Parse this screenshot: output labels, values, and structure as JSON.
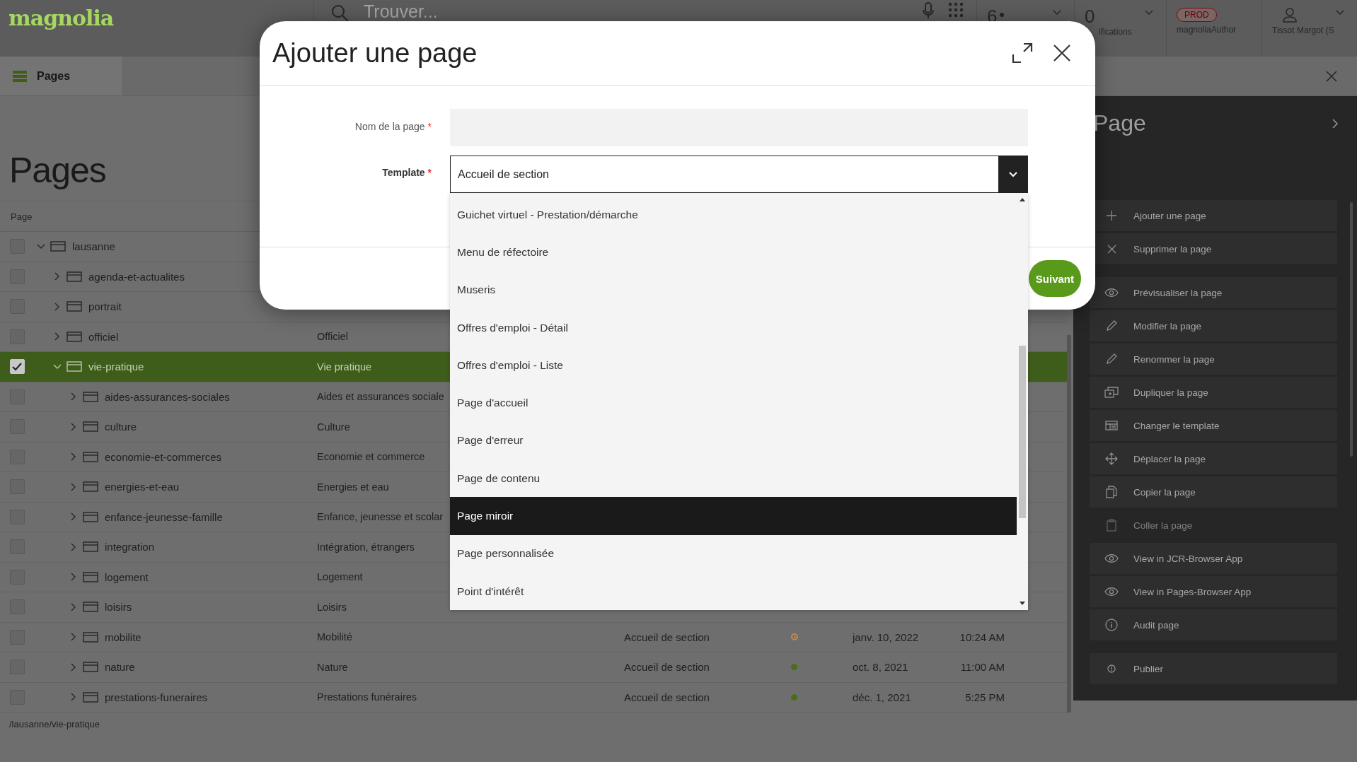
{
  "app": {
    "logo": "magnolia",
    "search": {
      "placeholder": "Trouver..."
    },
    "tasks_count": "6",
    "notifications": {
      "count": "0",
      "label": "ifications"
    },
    "environment": {
      "badge": "PROD",
      "user_role": "magnoliaAuthor"
    },
    "user": {
      "name": "Tissot Margot (S"
    }
  },
  "tab": {
    "label": "Pages"
  },
  "workspace": {
    "title": "Pages",
    "table": {
      "columns": [
        "Page"
      ],
      "rows": [
        {
          "name": "lausanne",
          "selected": false,
          "expanded": true,
          "children": [
            {
              "name": "agenda-et-actualites",
              "selected": false,
              "expanded": false
            },
            {
              "name": "portrait",
              "selected": false,
              "expanded": false
            },
            {
              "name": "officiel",
              "title": "Officiel",
              "selected": false,
              "expanded": false
            },
            {
              "name": "vie-pratique",
              "title": "Vie pratique",
              "selected": true,
              "expanded": true,
              "children": [
                {
                  "name": "aides-assurances-sociales",
                  "title": "Aides et assurances sociale",
                  "selected": false,
                  "expanded": false
                },
                {
                  "name": "culture",
                  "title": "Culture",
                  "selected": false,
                  "expanded": false
                },
                {
                  "name": "economie-et-commerces",
                  "title": "Economie et commerce",
                  "selected": false,
                  "expanded": false
                },
                {
                  "name": "energies-et-eau",
                  "title": "Energies et eau",
                  "selected": false,
                  "expanded": false
                },
                {
                  "name": "enfance-jeunesse-famille",
                  "title": "Enfance, jeunesse et scolar",
                  "selected": false,
                  "expanded": false
                },
                {
                  "name": "integration",
                  "title": "Intégration, étrangers",
                  "selected": false,
                  "expanded": false
                },
                {
                  "name": "logement",
                  "title": "Logement",
                  "selected": false,
                  "expanded": false
                },
                {
                  "name": "loisirs",
                  "title": "Loisirs",
                  "selected": false,
                  "expanded": false
                },
                {
                  "name": "mobilite",
                  "title": "Mobilité",
                  "template": "Accueil de section",
                  "status": {
                    "kind": "modified",
                    "color": "#c08a4a"
                  },
                  "date": "janv. 10, 2022",
                  "time": "10:24 AM",
                  "selected": false,
                  "expanded": false
                },
                {
                  "name": "nature",
                  "title": "Nature",
                  "template": "Accueil de section",
                  "status": {
                    "kind": "published",
                    "color": "#4a6e1c"
                  },
                  "date": "oct. 8, 2021",
                  "time": "11:00 AM",
                  "selected": false,
                  "expanded": false
                },
                {
                  "name": "prestations-funeraires",
                  "title": "Prestations funéraires",
                  "template": "Accueil de section",
                  "status": {
                    "kind": "published",
                    "color": "#4a6e1c"
                  },
                  "date": "déc. 1, 2021",
                  "time": "5:25 PM",
                  "selected": false,
                  "expanded": false
                }
              ]
            }
          ]
        }
      ]
    },
    "path": "/lausanne/vie-pratique"
  },
  "action_panel": {
    "title": "Page",
    "groups": [
      {
        "items": [
          {
            "label": "Ajouter une page",
            "disabled": false
          },
          {
            "label": "Supprimer la page",
            "disabled": false
          }
        ]
      },
      {
        "items": [
          {
            "label": "Prévisualiser la page",
            "disabled": false
          },
          {
            "label": "Modifier la page",
            "disabled": false
          },
          {
            "label": "Renommer la page",
            "disabled": false
          },
          {
            "label": "Dupliquer la page",
            "disabled": false
          },
          {
            "label": "Changer le template",
            "disabled": false
          },
          {
            "label": "Déplacer la page",
            "disabled": false
          },
          {
            "label": "Copier la page",
            "disabled": false
          },
          {
            "label": "Coller la page",
            "disabled": true
          },
          {
            "label": "View in JCR-Browser App",
            "disabled": false
          },
          {
            "label": "View in Pages-Browser App",
            "disabled": false
          },
          {
            "label": "Audit page",
            "disabled": false
          }
        ]
      },
      {
        "items": [
          {
            "label": "Publier",
            "disabled": false
          }
        ]
      }
    ]
  },
  "dialog": {
    "title": "Ajouter une page",
    "fields": [
      {
        "kind": "text",
        "label": "Nom de la page",
        "required_mark": "*"
      },
      {
        "kind": "select",
        "label": "Template",
        "required_mark": "*",
        "value": "Accueil de section",
        "options": [
          {
            "label": "Guichet virtuel - Prestation/démarche",
            "selected": false
          },
          {
            "label": "Menu de réfectoire",
            "selected": false
          },
          {
            "label": "Museris",
            "selected": false
          },
          {
            "label": "Offres d'emploi - Détail",
            "selected": false
          },
          {
            "label": "Offres d'emploi - Liste",
            "selected": false
          },
          {
            "label": "Page d'accueil",
            "selected": false
          },
          {
            "label": "Page d'erreur",
            "selected": false
          },
          {
            "label": "Page de contenu",
            "selected": false
          },
          {
            "label": "Page miroir",
            "selected": true
          },
          {
            "label": "Page personnalisée",
            "selected": false
          },
          {
            "label": "Point d'intérêt",
            "selected": false
          }
        ]
      }
    ],
    "buttons": [
      {
        "label": "Suivant"
      }
    ]
  }
}
